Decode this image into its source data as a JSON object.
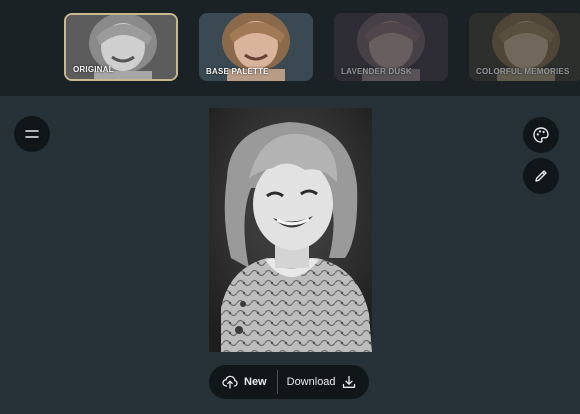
{
  "presets": [
    {
      "label": "ORIGINAL",
      "selected": true
    },
    {
      "label": "BASE PALETTE",
      "selected": false
    },
    {
      "label": "LAVENDER DUSK",
      "selected": false
    },
    {
      "label": "COLORFUL MEMORIES",
      "selected": false
    }
  ],
  "side_buttons": {
    "menu_icon": "menu-icon",
    "palette_icon": "palette-icon",
    "edit_icon": "pencil-icon"
  },
  "actions": {
    "new_label": "New",
    "download_label": "Download"
  },
  "colors": {
    "background": "#263238",
    "topbar": "#1b2226",
    "button": "#111719",
    "selected_border": "#c9b98f"
  }
}
